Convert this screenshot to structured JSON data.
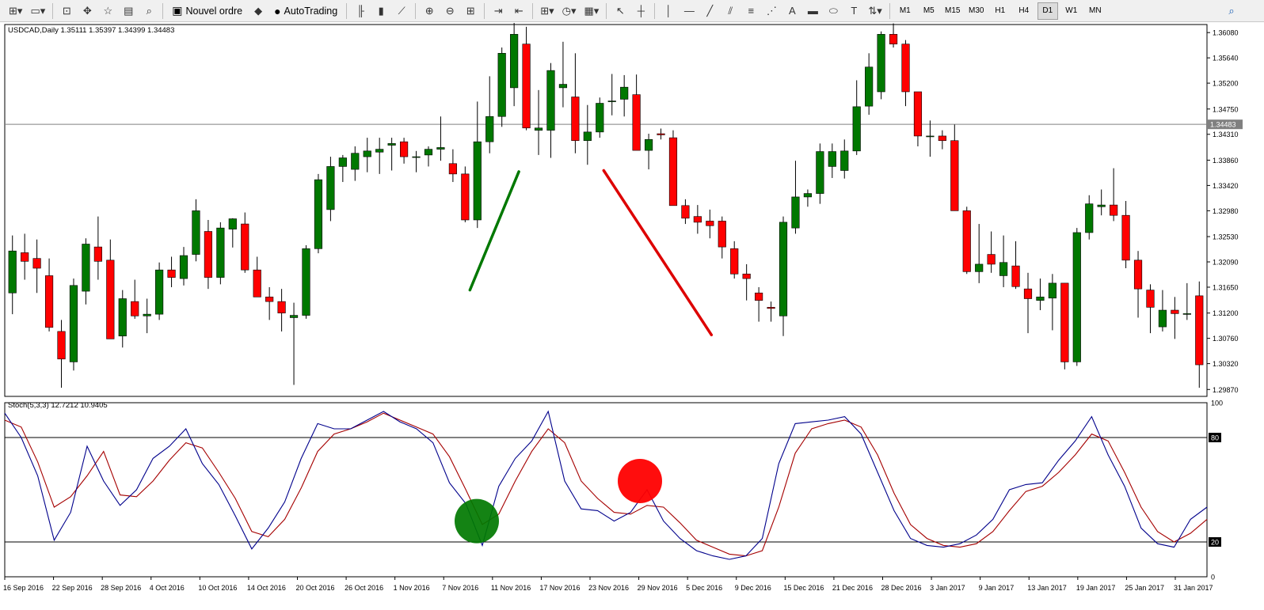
{
  "toolbar": {
    "new_order_label": "Nouvel ordre",
    "autotrading_label": "AutoTrading",
    "timeframes": [
      "M1",
      "M5",
      "M15",
      "M30",
      "H1",
      "H4",
      "D1",
      "W1",
      "MN"
    ],
    "active_timeframe": "D1",
    "icons": [
      "new-chart-icon",
      "profiles-icon",
      "market-watch-icon",
      "navigator-icon",
      "favorites-icon",
      "data-window-icon",
      "strategy-tester-icon",
      "new-order-icon",
      "autotrading-icon",
      "bar-chart-icon",
      "candlestick-icon",
      "line-chart-icon",
      "zoom-in-icon",
      "zoom-out-icon",
      "tile-windows-icon",
      "auto-scroll-icon",
      "chart-shift-icon",
      "indicators-icon",
      "periods-icon",
      "templates-icon",
      "cursor-icon",
      "crosshair-icon",
      "vertical-line-icon",
      "horizontal-line-icon",
      "trendline-icon",
      "equidistant-channel-icon",
      "fibonacci-icon",
      "fibo-fan-icon",
      "text-icon",
      "rectangle-icon",
      "ellipse-icon",
      "text-label-icon",
      "arrows-icon",
      "search-icon"
    ]
  },
  "chart_data": {
    "type": "candlestick",
    "symbol_info": "USDCAD,Daily  1.35111 1.35397 1.34399 1.34483",
    "current_price_label": "1.34483",
    "current_price": 1.34483,
    "y_ticks": [
      "1.36080",
      "1.35640",
      "1.35200",
      "1.34750",
      "1.34310",
      "1.33860",
      "1.33420",
      "1.32980",
      "1.32530",
      "1.32090",
      "1.31650",
      "1.31200",
      "1.30760",
      "1.30320",
      "1.29870"
    ],
    "ylim": [
      1.2975,
      1.3622
    ],
    "x_ticks": [
      "16 Sep 2016",
      "22 Sep 2016",
      "28 Sep 2016",
      "4 Oct 2016",
      "10 Oct 2016",
      "14 Oct 2016",
      "20 Oct 2016",
      "26 Oct 2016",
      "1 Nov 2016",
      "7 Nov 2016",
      "11 Nov 2016",
      "17 Nov 2016",
      "23 Nov 2016",
      "29 Nov 2016",
      "5 Dec 2016",
      "9 Dec 2016",
      "15 Dec 2016",
      "21 Dec 2016",
      "28 Dec 2016",
      "3 Jan 2017",
      "9 Jan 2017",
      "13 Jan 2017",
      "19 Jan 2017",
      "25 Jan 2017",
      "31 Jan 2017"
    ],
    "candles_ohlc": [
      [
        1.3155,
        1.3255,
        1.3118,
        1.3228
      ],
      [
        1.3225,
        1.3258,
        1.3178,
        1.321
      ],
      [
        1.3215,
        1.3248,
        1.3155,
        1.3198
      ],
      [
        1.3185,
        1.3215,
        1.3088,
        1.3095
      ],
      [
        1.3088,
        1.3108,
        1.299,
        1.304
      ],
      [
        1.3035,
        1.318,
        1.302,
        1.3168
      ],
      [
        1.3158,
        1.325,
        1.3135,
        1.324
      ],
      [
        1.3235,
        1.3288,
        1.3178,
        1.321
      ],
      [
        1.3212,
        1.3248,
        1.3088,
        1.3075
      ],
      [
        1.308,
        1.316,
        1.306,
        1.3145
      ],
      [
        1.314,
        1.3178,
        1.311,
        1.3115
      ],
      [
        1.3115,
        1.3145,
        1.3085,
        1.3118
      ],
      [
        1.3118,
        1.3208,
        1.3108,
        1.3195
      ],
      [
        1.3195,
        1.3218,
        1.3165,
        1.3182
      ],
      [
        1.318,
        1.3235,
        1.3168,
        1.322
      ],
      [
        1.3222,
        1.3318,
        1.321,
        1.3298
      ],
      [
        1.3262,
        1.3282,
        1.3162,
        1.3182
      ],
      [
        1.3182,
        1.3278,
        1.317,
        1.3268
      ],
      [
        1.3266,
        1.3285,
        1.3234,
        1.3284
      ],
      [
        1.3275,
        1.3295,
        1.319,
        1.3195
      ],
      [
        1.3195,
        1.3218,
        1.3148,
        1.3148
      ],
      [
        1.3148,
        1.3165,
        1.3108,
        1.314
      ],
      [
        1.314,
        1.3162,
        1.3088,
        1.312
      ],
      [
        1.3112,
        1.3138,
        1.2995,
        1.3116
      ],
      [
        1.3116,
        1.3238,
        1.311,
        1.3232
      ],
      [
        1.3232,
        1.3362,
        1.3224,
        1.3352
      ],
      [
        1.33,
        1.3392,
        1.328,
        1.3375
      ],
      [
        1.3375,
        1.3395,
        1.3348,
        1.339
      ],
      [
        1.337,
        1.341,
        1.335,
        1.3398
      ],
      [
        1.3392,
        1.3425,
        1.3365,
        1.3402
      ],
      [
        1.34,
        1.3425,
        1.3362,
        1.3405
      ],
      [
        1.3412,
        1.3425,
        1.3368,
        1.3415
      ],
      [
        1.3418,
        1.3425,
        1.338,
        1.3392
      ],
      [
        1.3392,
        1.3402,
        1.3365,
        1.3392
      ],
      [
        1.3395,
        1.341,
        1.3375,
        1.3405
      ],
      [
        1.3405,
        1.3462,
        1.3385,
        1.3408
      ],
      [
        1.338,
        1.3405,
        1.3348,
        1.3362
      ],
      [
        1.3362,
        1.3375,
        1.3278,
        1.3282
      ],
      [
        1.3282,
        1.3488,
        1.3268,
        1.3418
      ],
      [
        1.3418,
        1.3532,
        1.3398,
        1.3462
      ],
      [
        1.3462,
        1.3582,
        1.3444,
        1.3572
      ],
      [
        1.3512,
        1.363,
        1.348,
        1.3605
      ],
      [
        1.3588,
        1.3618,
        1.3438,
        1.3442
      ],
      [
        1.3438,
        1.3508,
        1.3395,
        1.3442
      ],
      [
        1.3438,
        1.3555,
        1.339,
        1.3542
      ],
      [
        1.3512,
        1.3592,
        1.3478,
        1.3518
      ],
      [
        1.3496,
        1.3572,
        1.3398,
        1.342
      ],
      [
        1.342,
        1.3482,
        1.3378,
        1.3435
      ],
      [
        1.3435,
        1.3495,
        1.3425,
        1.3485
      ],
      [
        1.3489,
        1.3536,
        1.3464,
        1.3489
      ],
      [
        1.3492,
        1.3534,
        1.3462,
        1.3513
      ],
      [
        1.35,
        1.3535,
        1.342,
        1.3403
      ],
      [
        1.3403,
        1.3432,
        1.337,
        1.3422
      ],
      [
        1.3432,
        1.3441,
        1.3422,
        1.343
      ],
      [
        1.3425,
        1.3438,
        1.335,
        1.3307
      ],
      [
        1.3307,
        1.3318,
        1.3275,
        1.3285
      ],
      [
        1.3288,
        1.3308,
        1.3258,
        1.3278
      ],
      [
        1.328,
        1.33,
        1.325,
        1.3272
      ],
      [
        1.328,
        1.3288,
        1.3215,
        1.3235
      ],
      [
        1.3232,
        1.3245,
        1.318,
        1.3188
      ],
      [
        1.3188,
        1.3205,
        1.3142,
        1.318
      ],
      [
        1.3155,
        1.3165,
        1.3105,
        1.3142
      ],
      [
        1.313,
        1.314,
        1.3105,
        1.3128
      ],
      [
        1.3115,
        1.3288,
        1.308,
        1.3278
      ],
      [
        1.3268,
        1.3385,
        1.3258,
        1.3322
      ],
      [
        1.3322,
        1.3335,
        1.3305,
        1.3328
      ],
      [
        1.3328,
        1.3415,
        1.331,
        1.3401
      ],
      [
        1.3375,
        1.3415,
        1.3355,
        1.3401
      ],
      [
        1.3368,
        1.3422,
        1.3354,
        1.3402
      ],
      [
        1.3402,
        1.3525,
        1.3395,
        1.3479
      ],
      [
        1.348,
        1.3572,
        1.3465,
        1.3548
      ],
      [
        1.3505,
        1.361,
        1.3492,
        1.3605
      ],
      [
        1.3605,
        1.3624,
        1.3582,
        1.3588
      ],
      [
        1.3588,
        1.3595,
        1.348,
        1.3505
      ],
      [
        1.3505,
        1.3505,
        1.341,
        1.3428
      ],
      [
        1.3428,
        1.3455,
        1.3392,
        1.3428
      ],
      [
        1.3428,
        1.3438,
        1.3405,
        1.342
      ],
      [
        1.342,
        1.3448,
        1.3298,
        1.3298
      ],
      [
        1.3298,
        1.3305,
        1.3188,
        1.3192
      ],
      [
        1.3192,
        1.3275,
        1.3172,
        1.3205
      ],
      [
        1.3222,
        1.3262,
        1.319,
        1.3205
      ],
      [
        1.3185,
        1.3255,
        1.3165,
        1.3208
      ],
      [
        1.3202,
        1.3245,
        1.3162,
        1.3166
      ],
      [
        1.3162,
        1.319,
        1.3085,
        1.3145
      ],
      [
        1.3142,
        1.318,
        1.3125,
        1.3148
      ],
      [
        1.3146,
        1.3188,
        1.309,
        1.3172
      ],
      [
        1.3172,
        1.3172,
        1.3022,
        1.3035
      ],
      [
        1.3035,
        1.3268,
        1.3028,
        1.326
      ],
      [
        1.326,
        1.3325,
        1.3248,
        1.331
      ],
      [
        1.3305,
        1.3335,
        1.329,
        1.3308
      ],
      [
        1.3308,
        1.3372,
        1.328,
        1.329
      ],
      [
        1.329,
        1.3315,
        1.3198,
        1.3212
      ],
      [
        1.3212,
        1.3228,
        1.3112,
        1.3162
      ],
      [
        1.316,
        1.317,
        1.3085,
        1.313
      ],
      [
        1.3096,
        1.316,
        1.3088,
        1.3125
      ],
      [
        1.3125,
        1.3148,
        1.3075,
        1.3119
      ],
      [
        1.3119,
        1.3172,
        1.3108,
        1.3119
      ],
      [
        1.315,
        1.3175,
        1.299,
        1.303
      ]
    ],
    "stochastic": {
      "label": "Stoch(5,3,3) 12.7212 10.9405",
      "params": [
        5,
        3,
        3
      ],
      "main_value": 12.7212,
      "signal_value": 10.9405,
      "ylim": [
        0,
        100
      ],
      "levels": [
        80,
        20
      ],
      "y_ticks": [
        "100",
        "80",
        "20",
        "0"
      ],
      "main_line": [
        94,
        80,
        58,
        21,
        37,
        75,
        55,
        41,
        50,
        68,
        75,
        85,
        65,
        53,
        35,
        16,
        28,
        43,
        68,
        88,
        85,
        85,
        90,
        95,
        89,
        85,
        77,
        54,
        42,
        18,
        52,
        68,
        78,
        95,
        55,
        39,
        38,
        32,
        37,
        50,
        32,
        22,
        15,
        12,
        10,
        12,
        22,
        65,
        88,
        89,
        90,
        92,
        82,
        60,
        38,
        22,
        18,
        17,
        19,
        24,
        33,
        50,
        53,
        54,
        67,
        78,
        92,
        70,
        52,
        28,
        19,
        17,
        33,
        40
      ],
      "signal_line": [
        90,
        86,
        66,
        40,
        46,
        58,
        72,
        47,
        46,
        55,
        67,
        77,
        74,
        60,
        45,
        26,
        23,
        33,
        51,
        72,
        82,
        85,
        89,
        94,
        90,
        86,
        82,
        69,
        50,
        30,
        36,
        55,
        72,
        85,
        77,
        55,
        45,
        37,
        36,
        41,
        40,
        31,
        21,
        17,
        13,
        12,
        15,
        40,
        71,
        85,
        88,
        90,
        86,
        70,
        48,
        30,
        22,
        18,
        17,
        19,
        26,
        38,
        49,
        52,
        60,
        70,
        82,
        78,
        60,
        40,
        26,
        20,
        25,
        33
      ]
    }
  },
  "drawing_objects": {
    "green_trendline": {
      "color": "#007800"
    },
    "red_trendline": {
      "color": "#dd0000"
    },
    "green_circle": {
      "color": "#007800"
    },
    "red_circle": {
      "color": "#ff0000"
    }
  },
  "colors": {
    "bull": "#007800",
    "bear": "#ff0000",
    "wick": "#000000",
    "stoch_main": "#00008b",
    "stoch_signal": "#a50000",
    "grid_text": "#000000",
    "price_line": "#808080"
  }
}
